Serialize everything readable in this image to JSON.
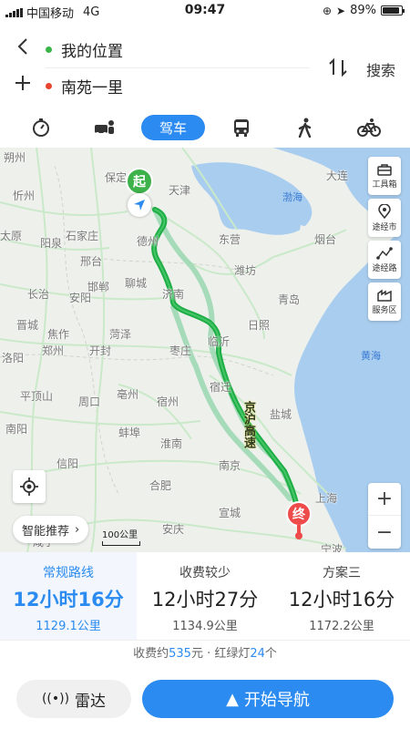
{
  "status": {
    "carrier": "中国移动",
    "network": "4G",
    "time": "09:47",
    "battery": "89%",
    "battery_level": 0.89
  },
  "route": {
    "origin": "我的位置",
    "destination": "南苑一里",
    "search_label": "搜索"
  },
  "modes": {
    "active_label": "驾车",
    "items": [
      "taxi-icon",
      "carpool-icon",
      "驾车",
      "bus-icon",
      "walk-icon",
      "bike-icon"
    ]
  },
  "map": {
    "tools": [
      {
        "label": "工具箱",
        "icon": "toolbox-icon"
      },
      {
        "label": "途经市",
        "icon": "location-icon"
      },
      {
        "label": "途经路",
        "icon": "route-icon"
      },
      {
        "label": "服务区",
        "icon": "service-icon"
      }
    ],
    "start_pin": "起",
    "end_pin": "终",
    "smart_recommend": "智能推荐",
    "scale_label": "100公里",
    "highway_label": "京沪高速",
    "cities": {
      "shuozhou": "朔州",
      "xinzhou": "忻州",
      "baoding": "保定",
      "tianjin": "天津",
      "dalian": "大连",
      "taiyuan": "太原",
      "yangquan": "阳泉",
      "shijiazhuang": "石家庄",
      "dezhou": "德州",
      "dongying": "东营",
      "yantai": "烟台",
      "weifang": "潍坊",
      "xingtai": "邢台",
      "handan": "邯郸",
      "changzhi": "长治",
      "anyang": "安阳",
      "liaocheng": "聊城",
      "jinan": "济南",
      "qingdao": "青岛",
      "jincheng": "晋城",
      "jiaozuo": "焦作",
      "heze": "菏泽",
      "linyi": "临沂",
      "rizhao": "日照",
      "luoyang": "洛阳",
      "zhengzhou": "郑州",
      "kaifeng": "开封",
      "zaozhuang": "枣庄",
      "pingdingshan": "平顶山",
      "zhoukou": "周口",
      "bozhou": "亳州",
      "suqian": "宿迁",
      "yancheng": "盐城",
      "suzhou_ah": "宿州",
      "bengbu": "蚌埠",
      "huainan": "淮南",
      "nanyang": "南阳",
      "xinyang": "信阳",
      "hefei": "合肥",
      "nanjing": "南京",
      "shanghai": "上海",
      "anqing": "安庆",
      "xuancheng": "宣城",
      "ningbo": "宁波",
      "xianning": "咸宁"
    },
    "seas": {
      "bohai": "渤海",
      "huanghai": "黄海"
    }
  },
  "plans": [
    {
      "name": "常规路线",
      "time": "12小时16分",
      "distance": "1129.1公里",
      "active": true
    },
    {
      "name": "收费较少",
      "time": "12小时27分",
      "distance": "1134.9公里",
      "active": false
    },
    {
      "name": "方案三",
      "time": "12小时16分",
      "distance": "1172.2公里",
      "active": false
    }
  ],
  "summary": {
    "toll_prefix": "收费约",
    "toll_value": "535",
    "toll_unit": "元 · 红绿灯",
    "lights_value": "24",
    "lights_unit": "个"
  },
  "buttons": {
    "radar": "雷达",
    "start_nav": "开始导航"
  },
  "colors": {
    "accent": "#2b8bf0",
    "route_main": "#1fae45",
    "route_alt": "#9fd9b5",
    "start_pin": "#3db24a",
    "end_pin": "#ee4b4b"
  }
}
